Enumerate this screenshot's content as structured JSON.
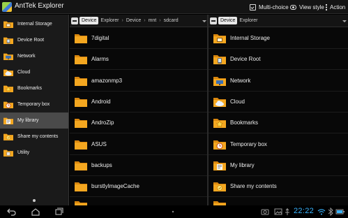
{
  "app": {
    "title": "AntTek Explorer",
    "actions": [
      {
        "label": "Multi-choice",
        "icon": "multi-choice-icon"
      },
      {
        "label": "View style",
        "icon": "eye-icon"
      },
      {
        "label": "Action",
        "icon": "kebab-menu-icon"
      }
    ]
  },
  "colors": {
    "folder": "#f4a720",
    "folder_tab": "#d9870f",
    "active_item": "#4a4a4a",
    "clock": "#39b4ff"
  },
  "sidebar": {
    "items": [
      {
        "label": "Internal Storage",
        "icon": "internal-storage-icon"
      },
      {
        "label": "Device Root",
        "icon": "device-root-icon"
      },
      {
        "label": "Network",
        "icon": "network-icon"
      },
      {
        "label": "Cloud",
        "icon": "cloud-icon"
      },
      {
        "label": "Bookmarks",
        "icon": "bookmark-icon"
      },
      {
        "label": "Temporary box",
        "icon": "temporary-box-icon"
      },
      {
        "label": "My library",
        "icon": "library-icon",
        "active": true
      },
      {
        "label": "Share my contents",
        "icon": "share-icon"
      },
      {
        "label": "Utility",
        "icon": "utility-icon"
      }
    ]
  },
  "left_pane": {
    "path": [
      "Device",
      "Explorer",
      "Device",
      "mnt",
      "sdcard"
    ],
    "items": [
      "7digital",
      "Alarms",
      "amazonmp3",
      "Android",
      "AndroZip",
      "ASUS",
      "backups",
      "burstlyImageCache"
    ]
  },
  "right_pane": {
    "path": [
      "Device",
      "Explorer"
    ],
    "items": [
      {
        "label": "Internal Storage",
        "icon": "internal-storage-icon"
      },
      {
        "label": "Device Root",
        "icon": "device-root-icon"
      },
      {
        "label": "Network",
        "icon": "network-icon"
      },
      {
        "label": "Cloud",
        "icon": "cloud-icon"
      },
      {
        "label": "Bookmarks",
        "icon": "bookmark-icon"
      },
      {
        "label": "Temporary box",
        "icon": "temporary-box-icon"
      },
      {
        "label": "My library",
        "icon": "library-icon"
      },
      {
        "label": "Share my contents",
        "icon": "share-icon"
      }
    ]
  },
  "status": {
    "time": "22:22"
  }
}
